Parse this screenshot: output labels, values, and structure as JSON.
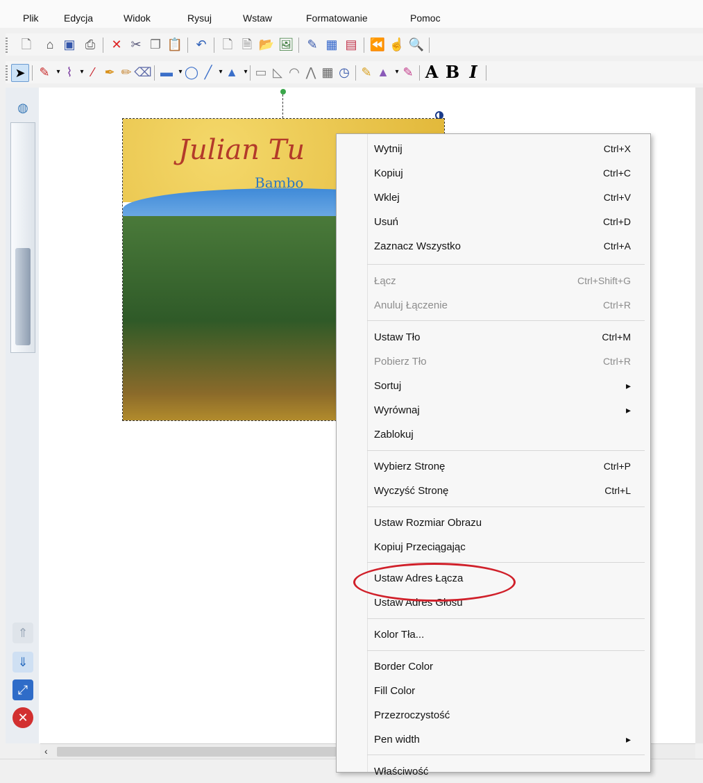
{
  "menubar": {
    "items": [
      "Plik",
      "Edycja",
      "Widok",
      "Rysuj",
      "Wstaw",
      "Formatowanie",
      "Pomoc"
    ]
  },
  "toolbar2": {
    "text_a": "A",
    "text_b": "B",
    "text_i": "I"
  },
  "canvas": {
    "book_title": "Julian Tu",
    "book_subtitle": "Bambo"
  },
  "context_menu": {
    "items": [
      {
        "label": "Wytnij",
        "shortcut": "Ctrl+X"
      },
      {
        "label": "Kopiuj",
        "shortcut": "Ctrl+C"
      },
      {
        "label": "Wklej",
        "shortcut": "Ctrl+V"
      },
      {
        "label": "Usuń",
        "shortcut": "Ctrl+D"
      },
      {
        "label": "Zaznacz  Wszystko",
        "shortcut": "Ctrl+A"
      },
      {
        "label": "Łącz",
        "shortcut": "Ctrl+Shift+G"
      },
      {
        "label": "Anuluj Łączenie",
        "shortcut": "Ctrl+R"
      },
      {
        "label": "Ustaw Tło",
        "shortcut": "Ctrl+M"
      },
      {
        "label": "Pobierz Tło",
        "shortcut": "Ctrl+R"
      },
      {
        "label": "Sortuj",
        "shortcut": "▸"
      },
      {
        "label": "Wyrównaj",
        "shortcut": "▸"
      },
      {
        "label": "Zablokuj",
        "shortcut": ""
      },
      {
        "label": "Wybierz Stronę",
        "shortcut": "Ctrl+P"
      },
      {
        "label": "Wyczyść Stronę",
        "shortcut": "Ctrl+L"
      },
      {
        "label": "Ustaw  Rozmiar Obrazu",
        "shortcut": ""
      },
      {
        "label": "Kopiuj Przeciągając",
        "shortcut": ""
      },
      {
        "label": "Ustaw Adres  Łącza",
        "shortcut": ""
      },
      {
        "label": "Ustaw Adres  Głosu",
        "shortcut": ""
      },
      {
        "label": "Kolor  Tła...",
        "shortcut": ""
      },
      {
        "label": "Border Color",
        "shortcut": ""
      },
      {
        "label": "Fill Color",
        "shortcut": ""
      },
      {
        "label": "Przezroczystość",
        "shortcut": ""
      },
      {
        "label": "Pen width",
        "shortcut": "▸"
      },
      {
        "label": "Właściwość",
        "shortcut": ""
      }
    ]
  },
  "colors": {
    "highlight": "#d0202a",
    "selection_handle": "#3aa64a",
    "disabled_text": "#8c8c8c"
  }
}
